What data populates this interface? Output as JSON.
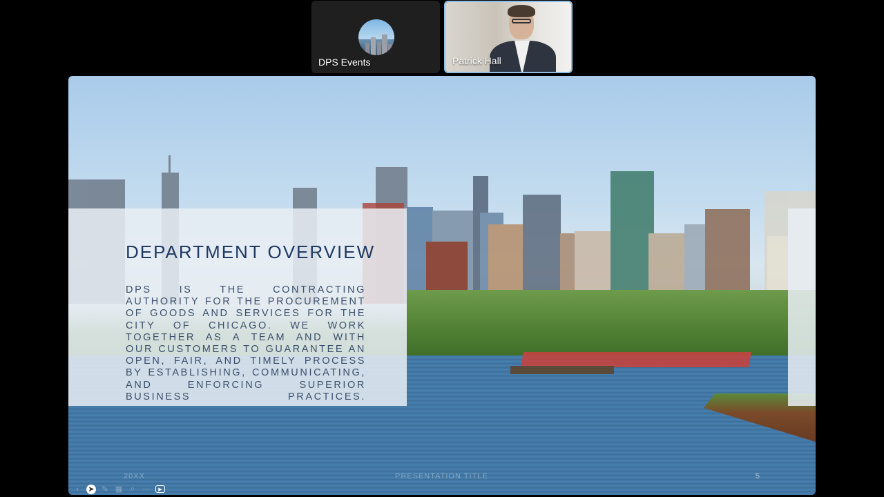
{
  "participants": [
    {
      "name": "DPS Events"
    },
    {
      "name": "Patrick Hall"
    }
  ],
  "slide": {
    "title": "DEPARTMENT OVERVIEW",
    "body": "DPS IS THE CONTRACTING AUTHORITY FOR THE PROCUREMENT OF GOODS AND SERVICES FOR THE CITY OF CHICAGO. WE WORK TOGETHER AS A TEAM AND WITH OUR CUSTOMERS TO GUARANTEE AN OPEN, FAIR, AND TIMELY PROCESS BY ESTABLISHING, COMMUNICATING, AND ENFORCING SUPERIOR BUSINESS PRACTICES.",
    "footer_left": "20XX",
    "footer_center": "PRESENTATION TITLE",
    "page_number": "5"
  },
  "controls": [
    {
      "icon": "chevron-left-icon",
      "glyph": "‹"
    },
    {
      "icon": "pointer-icon",
      "glyph": "➤"
    },
    {
      "icon": "pen-icon",
      "glyph": "✎"
    },
    {
      "icon": "grid-icon",
      "glyph": "▦"
    },
    {
      "icon": "zoom-icon",
      "glyph": "⌕"
    },
    {
      "icon": "more-icon",
      "glyph": "⋯"
    },
    {
      "icon": "video-icon",
      "glyph": "▶"
    }
  ],
  "colors": {
    "title": "#1f3a63",
    "body": "#3a4f6b",
    "active_speaker_border": "#8fbfe6"
  }
}
